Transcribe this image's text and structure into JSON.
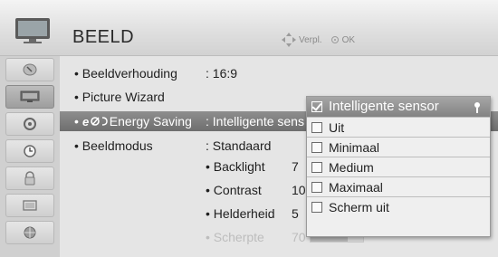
{
  "header": {
    "title": "BEELD",
    "hint_move": "Verpl.",
    "hint_ok": "OK",
    "tv_icon": "tv-icon"
  },
  "sidebar": {
    "items": [
      {
        "icon": "satellite-dish-icon"
      },
      {
        "icon": "picture-icon",
        "active": true
      },
      {
        "icon": "speaker-icon"
      },
      {
        "icon": "clock-icon"
      },
      {
        "icon": "lock-icon"
      },
      {
        "icon": "options-icon"
      },
      {
        "icon": "network-icon"
      }
    ]
  },
  "menu": {
    "rows": [
      {
        "label": "Beeldverhouding",
        "value": ": 16:9"
      },
      {
        "label": "Picture Wizard",
        "value": ""
      },
      {
        "label": "Energy Saving",
        "value": ": Intelligente sens",
        "prefix": "eco-icon"
      },
      {
        "label": "Beeldmodus",
        "value": ": Standaard"
      }
    ],
    "sub": [
      {
        "label": "Backlight",
        "value": "7",
        "level": 0.7
      },
      {
        "label": "Contrast",
        "value": "10",
        "level": 0.95
      },
      {
        "label": "Helderheid",
        "value": "5",
        "level": 0.5
      },
      {
        "label": "Scherpte",
        "value": "70",
        "level": 0.7,
        "dim": true
      }
    ]
  },
  "dropdown": {
    "selected": "Intelligente sensor",
    "options": [
      "Uit",
      "Minimaal",
      "Medium",
      "Maximaal",
      "Scherm uit"
    ]
  },
  "colors": {
    "selected_row": "#7e7e7e",
    "dropdown_header": "#959595",
    "background": "#e5e5e5"
  }
}
